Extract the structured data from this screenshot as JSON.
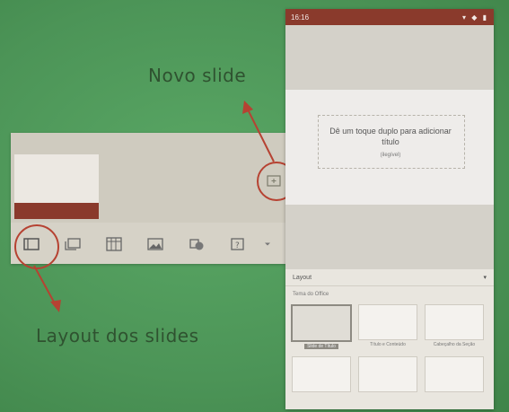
{
  "callouts": {
    "novo_slide": "Novo slide",
    "layout_dos_slides": "Layout dos slides"
  },
  "phone": {
    "status_time": "16:16",
    "slide_title": "Dê um toque duplo para adicionar título",
    "slide_subtitle": "(ilegível)",
    "panel_title": "Layout",
    "panel_sub": "Tema do Office",
    "layouts": [
      {
        "label": "Slide de Título"
      },
      {
        "label": "Título e Conteúdo"
      },
      {
        "label": "Cabeçalho da Seção"
      },
      {
        "label": ""
      },
      {
        "label": ""
      },
      {
        "label": ""
      }
    ]
  },
  "colors": {
    "accent": "#8a3a2c",
    "callout_ring": "#b64232",
    "background": "#4f9a5a"
  },
  "icons": [
    "layout-icon",
    "new-slide-icon",
    "table-icon",
    "image-icon",
    "shapes-icon",
    "more-icon",
    "dropdown-icon"
  ]
}
